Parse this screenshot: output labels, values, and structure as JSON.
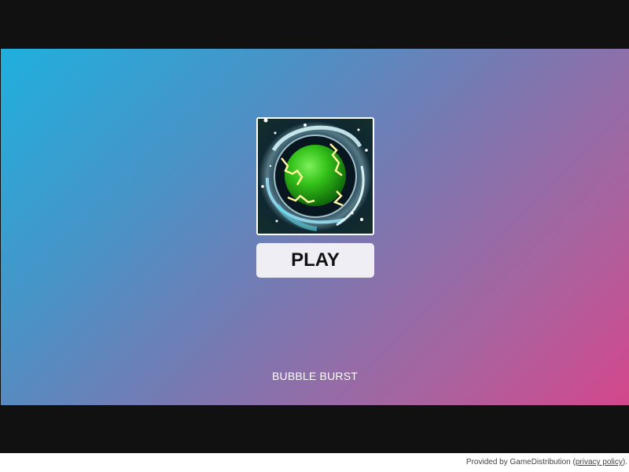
{
  "game": {
    "title": "BUBBLE BURST",
    "play_label": "PLAY",
    "thumbnail_icon": "green-energy-orb-icon"
  },
  "footer": {
    "provided_by": "Provided by GameDistribution (",
    "privacy_link": "privacy policy",
    "suffix": ")."
  },
  "colors": {
    "gradient_start": "#1fb0de",
    "gradient_end": "#d4478c",
    "letterbox": "#111111",
    "button_bg": "#f0eef5",
    "orb": "#35c21a"
  }
}
